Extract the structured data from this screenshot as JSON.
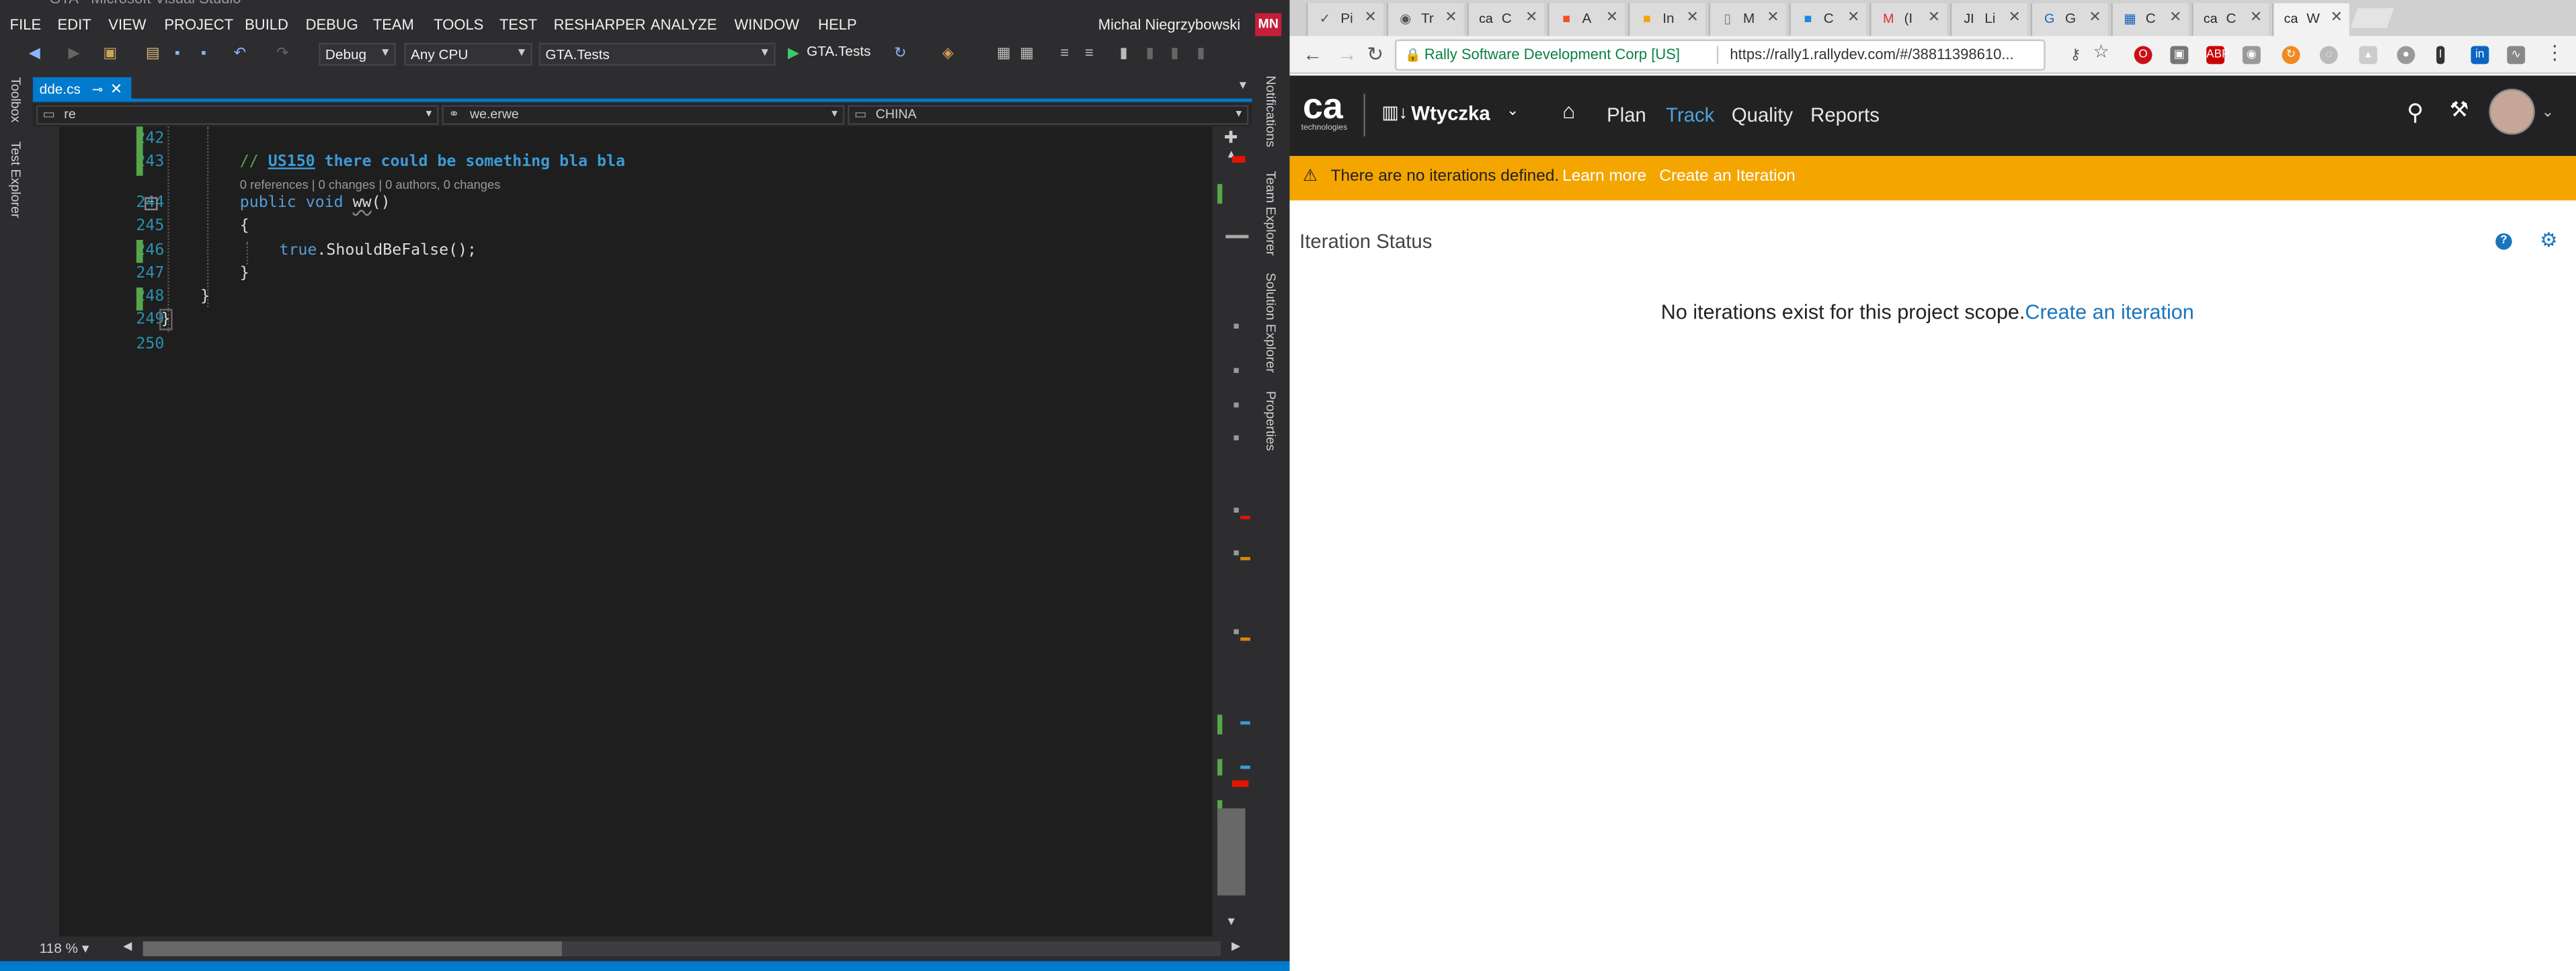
{
  "vs": {
    "title": "GTA - Microsoft Visual Studio",
    "menu": [
      "FILE",
      "EDIT",
      "VIEW",
      "PROJECT",
      "BUILD",
      "DEBUG",
      "TEAM",
      "TOOLS",
      "TEST",
      "RESHARPER",
      "ANALYZE",
      "WINDOW",
      "HELP"
    ],
    "user": "Michal Niegrzybowski",
    "user_initials": "MN",
    "toolbar": {
      "config": "Debug",
      "platform": "Any CPU",
      "startup": "GTA.Tests",
      "run_label": "GTA.Tests"
    },
    "left_panels": [
      "Toolbox",
      "Test Explorer"
    ],
    "right_panels": [
      "Notifications",
      "Team Explorer",
      "Solution Explorer",
      "Properties"
    ],
    "tab": {
      "name": "dde.cs"
    },
    "nav": {
      "scope": "re",
      "member": "we.erwe",
      "extra": "CHINA"
    },
    "lines": [
      {
        "n": "242",
        "code": ""
      },
      {
        "n": "243",
        "code": "// US150 there could be something bla bla"
      },
      {
        "n": "244",
        "code": "public void ww()"
      },
      {
        "n": "245",
        "code": "{"
      },
      {
        "n": "246",
        "code": "true.ShouldBeFalse();"
      },
      {
        "n": "247",
        "code": "}"
      },
      {
        "n": "248",
        "code": "}"
      },
      {
        "n": "249",
        "code": "}"
      },
      {
        "n": "250",
        "code": ""
      }
    ],
    "comment": {
      "prefix": "// ",
      "ref": "US150",
      "rest": " there could be something bla bla"
    },
    "codelens": "0 references | 0 changes | 0 authors, 0 changes",
    "method": {
      "kw1": "public",
      "kw2": "void",
      "name": "ww",
      "parens": "()"
    },
    "body_stmt": {
      "kw": "true",
      "rest": ".ShouldBeFalse();"
    },
    "zoom": "118 %"
  },
  "chrome": {
    "tabs": [
      {
        "label": "Pi",
        "icon": "✓",
        "color": "#555"
      },
      {
        "label": "Tr",
        "icon": "◉",
        "color": "#555"
      },
      {
        "label": "C",
        "icon": "ca",
        "color": "#222"
      },
      {
        "label": "A",
        "icon": "■",
        "color": "#f25022"
      },
      {
        "label": "In",
        "icon": "■",
        "color": "#f4a500"
      },
      {
        "label": "M",
        "icon": "▯",
        "color": "#777"
      },
      {
        "label": "C",
        "icon": "■",
        "color": "#1e88e5"
      },
      {
        "label": "(I",
        "icon": "M",
        "color": "#d93025"
      },
      {
        "label": "Li",
        "icon": "JI",
        "color": "#222"
      },
      {
        "label": "G",
        "icon": "G",
        "color": "#1565c0"
      },
      {
        "label": "C",
        "icon": "▦",
        "color": "#1565c0"
      },
      {
        "label": "C",
        "icon": "ca",
        "color": "#222"
      },
      {
        "label": "W",
        "icon": "ca",
        "color": "#222"
      }
    ],
    "address": {
      "org": "Rally Software Development Corp [US]",
      "url": "https://rally1.rallydev.com/#/38811398610..."
    }
  },
  "rally": {
    "logo": "ca",
    "logo_sub": "technologies",
    "project": "Wtyczka",
    "nav": [
      "Plan",
      "Track",
      "Quality",
      "Reports"
    ],
    "active_nav": "Track",
    "banner": {
      "message": "There are no iterations defined.",
      "learn_more": "Learn more",
      "create": "Create an Iteration"
    },
    "panel_title": "Iteration Status",
    "empty_message": "No iterations exist for this project scope.",
    "empty_link": "Create an iteration",
    "colors": {
      "banner": "#f4a500",
      "link": "#1b75bb",
      "active_nav": "#4ea1e0"
    }
  }
}
